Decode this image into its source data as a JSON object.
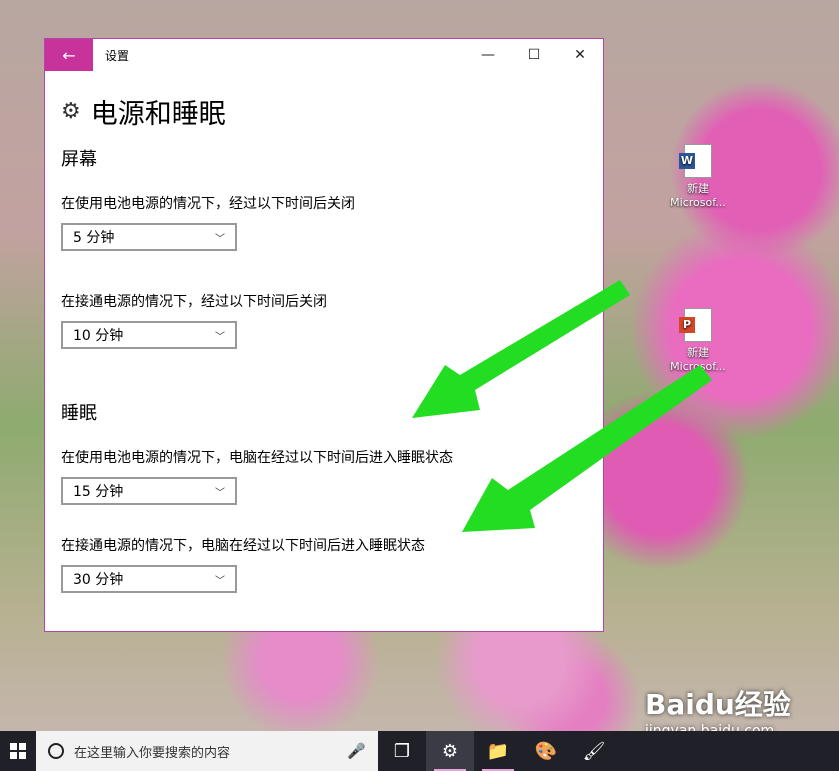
{
  "window": {
    "title": "设置",
    "back_icon": "←",
    "minimize_icon": "—",
    "maximize_icon": "☐",
    "close_icon": "✕"
  },
  "page": {
    "gear_icon": "⚙",
    "title": "电源和睡眠"
  },
  "screen_section": {
    "heading": "屏幕",
    "battery_label": "在使用电池电源的情况下，经过以下时间后关闭",
    "battery_value": "5 分钟",
    "plugged_label": "在接通电源的情况下，经过以下时间后关闭",
    "plugged_value": "10 分钟"
  },
  "sleep_section": {
    "heading": "睡眠",
    "battery_label": "在使用电池电源的情况下，电脑在经过以下时间后进入睡眠状态",
    "battery_value": "15 分钟",
    "plugged_label": "在接通电源的情况下，电脑在经过以下时间后进入睡眠状态",
    "plugged_value": "30 分钟"
  },
  "chevron_icon": "﹀",
  "desktop_icons": [
    {
      "line1": "新建",
      "line2": "Microsof...",
      "badge": "W"
    },
    {
      "line1": "新建",
      "line2": "Microsof...",
      "badge": "P"
    }
  ],
  "taskbar": {
    "search_placeholder": "在这里输入你要搜索的内容",
    "mic_icon": "🎤",
    "task_view_icon": "❐",
    "settings_icon": "⚙",
    "explorer_icon": "📁",
    "paint_icon": "🎨",
    "paint2_icon": "🖌"
  },
  "watermark": {
    "brand": "Baidu经验",
    "url": "jingyan.baidu.com"
  },
  "colors": {
    "accent": "#c8329b",
    "arrow": "#22dd22"
  }
}
